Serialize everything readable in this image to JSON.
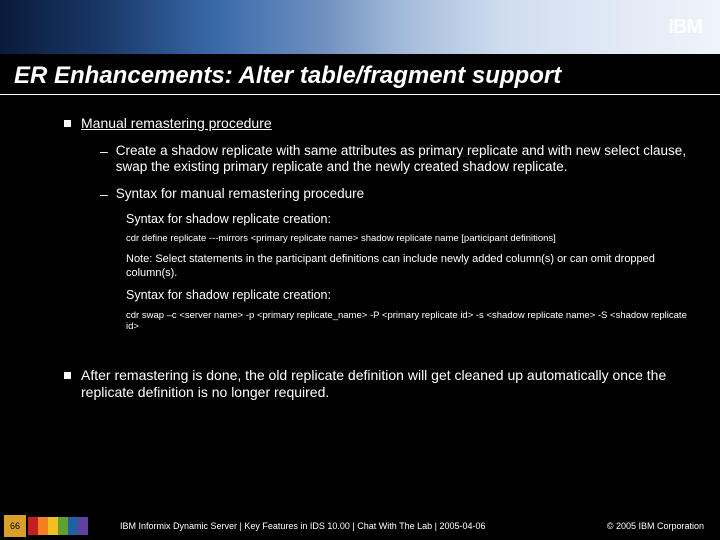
{
  "logo_text": "IBM",
  "title": "ER Enhancements: Alter table/fragment support",
  "b1": "Manual remastering procedure",
  "b2a": "Create a shadow replicate with same attributes as primary replicate and with new select clause, swap the existing primary replicate and the newly created shadow replicate.",
  "b2b": "Syntax for manual remastering procedure",
  "b3a": "Syntax for shadow replicate creation:",
  "b4a": "cdr define replicate ---mirrors <primary replicate name> shadow replicate name [participant definitions]",
  "b3b": "Note: Select statements in the participant definitions can include newly added column(s) or can omit dropped column(s).",
  "b3c": "Syntax for shadow replicate creation:",
  "b4b": "cdr swap –c <server name>  -p <primary replicate_name> -P <primary replicate id> -s <shadow replicate name>  -S <shadow replicate id>",
  "b1b": "After remastering is done, the old replicate definition will get cleaned up automatically once the replicate definition is no longer required.",
  "page_num": "66",
  "footer_text": "IBM Informix Dynamic Server  |  Key Features in IDS 10.00  |  Chat With The Lab  |  2005-04-06",
  "copyright": "© 2005 IBM Corporation",
  "colors": [
    "#c02020",
    "#f08020",
    "#f0c020",
    "#60a030",
    "#2060a0",
    "#6040a0"
  ]
}
